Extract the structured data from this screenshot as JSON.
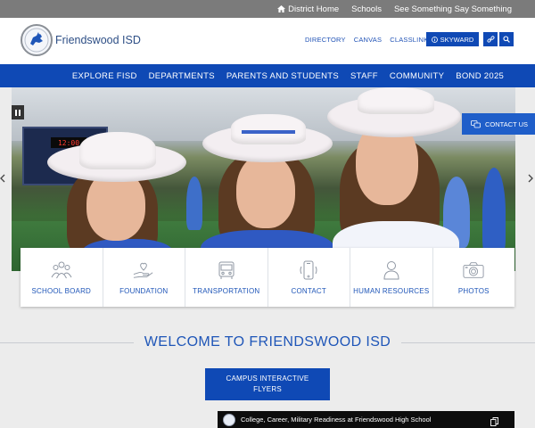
{
  "utility_bar": {
    "links": [
      "District Home",
      "Schools",
      "See Something Say Something"
    ]
  },
  "header": {
    "site_name": "Friendswood ISD",
    "links": [
      "DIRECTORY",
      "CANVAS",
      "CLASSLINK"
    ],
    "skyward_label": "SKYWARD"
  },
  "nav": {
    "items": [
      "EXPLORE FISD",
      "DEPARTMENTS",
      "PARENTS AND STUDENTS",
      "STAFF",
      "COMMUNITY",
      "BOND 2025"
    ]
  },
  "hero": {
    "scoreboard_time": "12:00",
    "contact_us_label": "CONTACT US"
  },
  "quick_links": [
    {
      "label": "SCHOOL BOARD",
      "icon": "people-group-icon"
    },
    {
      "label": "FOUNDATION",
      "icon": "hand-heart-icon"
    },
    {
      "label": "TRANSPORTATION",
      "icon": "bus-icon"
    },
    {
      "label": "CONTACT",
      "icon": "phone-icon"
    },
    {
      "label": "HUMAN RESOURCES",
      "icon": "person-icon"
    },
    {
      "label": "PHOTOS",
      "icon": "camera-icon"
    }
  ],
  "welcome": {
    "title": "WELCOME TO FRIENDSWOOD ISD",
    "campus_button": "CAMPUS INTERACTIVE FLYERS"
  },
  "video": {
    "title": "College, Career, Military Readiness at Friendswood High School"
  },
  "colors": {
    "brand_blue": "#0f49b5",
    "link_blue": "#1f56b8",
    "utility_gray": "#7b7b7b"
  }
}
